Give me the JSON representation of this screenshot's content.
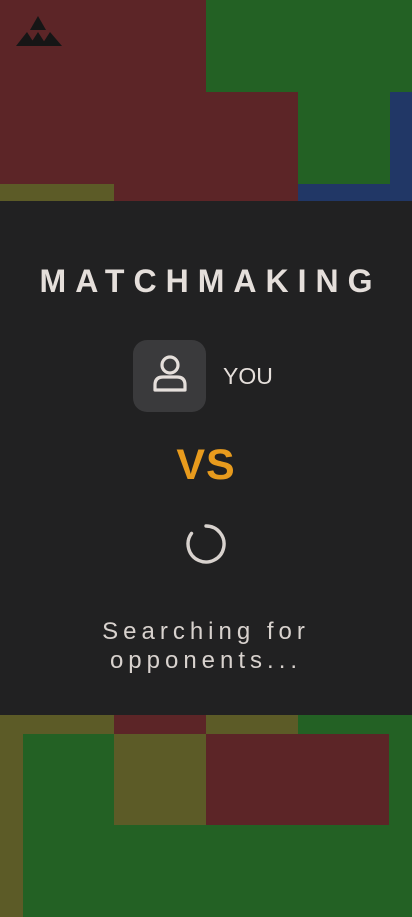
{
  "app": {
    "logo_icon": "triangle-logo-icon"
  },
  "board": {
    "colors": {
      "red": "#5c2527",
      "green": "#236124",
      "navy": "#213766",
      "olive": "#5c5b27"
    }
  },
  "matchmaking": {
    "title": "MATCHMAKING",
    "player_icon": "user-icon",
    "player_name": "YOU",
    "vs_label": "VS",
    "spinner_icon": "loading-spinner-icon",
    "status": "Searching for opponents...",
    "accent_color": "#e89b1d"
  }
}
